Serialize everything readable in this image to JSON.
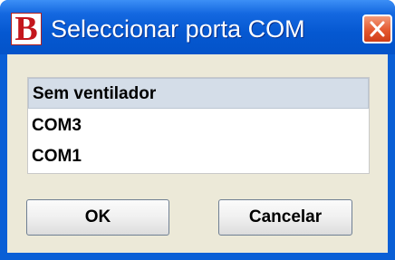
{
  "window": {
    "app_icon_letter": "B",
    "title": "Seleccionar porta COM",
    "close_icon": "close-x-icon"
  },
  "port_list": {
    "items": [
      {
        "label": "Sem ventilador",
        "selected": true
      },
      {
        "label": "COM3",
        "selected": false
      },
      {
        "label": "COM1",
        "selected": false
      }
    ]
  },
  "buttons": {
    "ok_label": "OK",
    "cancel_label": "Cancelar"
  },
  "colors": {
    "titlebar": "#0558d1",
    "client_bg": "#ece9d8",
    "selected_row": "#d4dde8",
    "close_button": "#e4582f",
    "app_icon_letter": "#c4161c"
  }
}
